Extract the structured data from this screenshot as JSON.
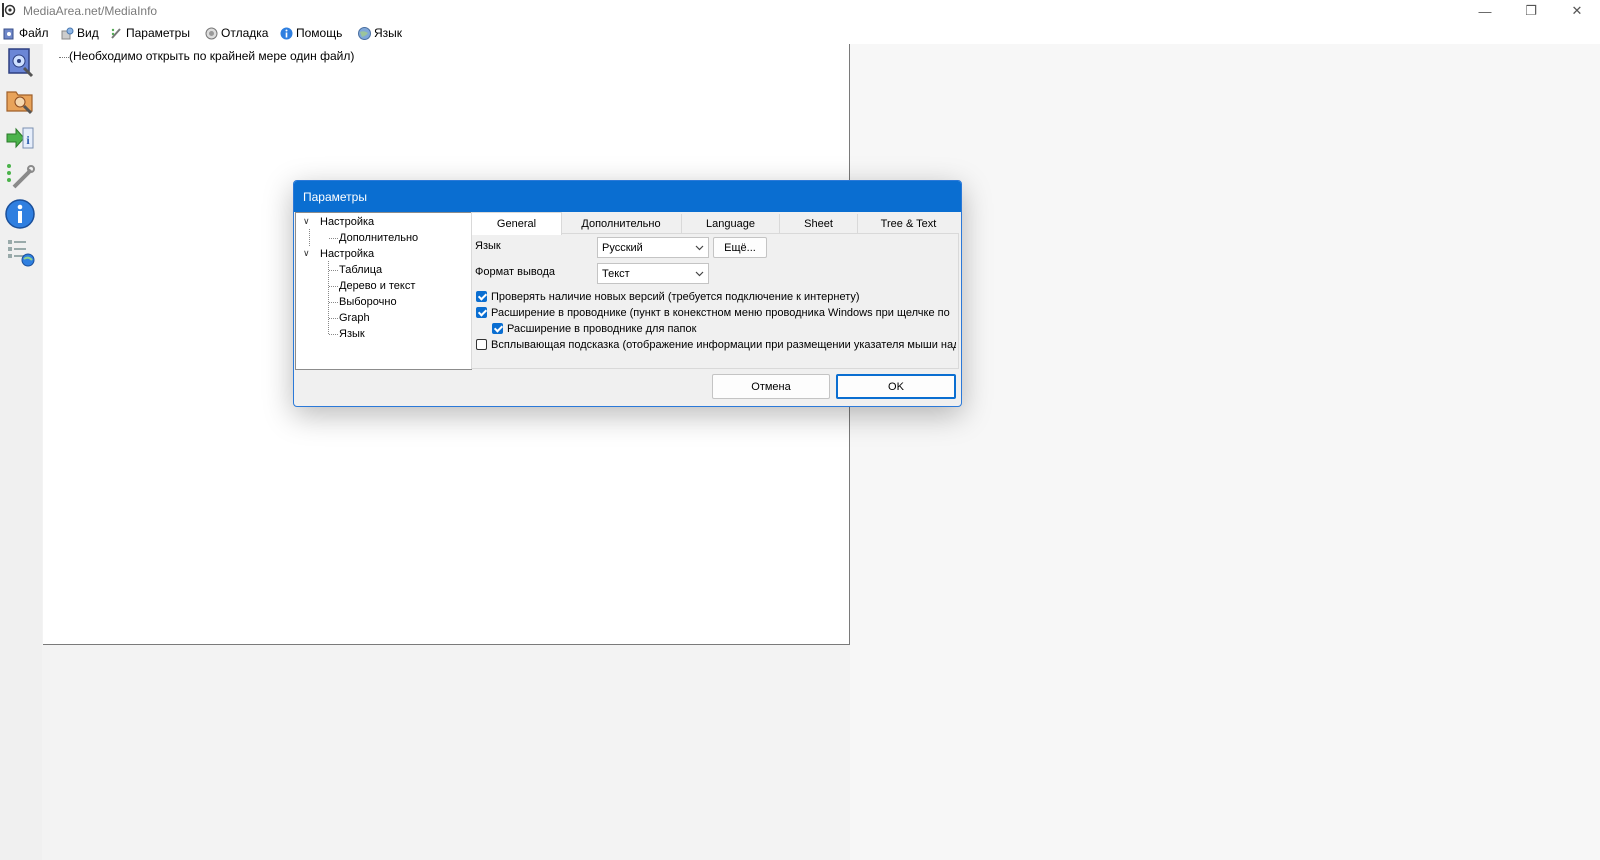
{
  "window": {
    "title": "MediaArea.net/MediaInfo",
    "controls": {
      "minimize": "—",
      "restore": "❐",
      "close": "✕"
    }
  },
  "menu": [
    {
      "label": "Файл",
      "icon": "file-icon"
    },
    {
      "label": "Вид",
      "icon": "view-icon"
    },
    {
      "label": "Параметры",
      "icon": "options-icon"
    },
    {
      "label": "Отладка",
      "icon": "debug-icon"
    },
    {
      "label": "Помощь",
      "icon": "help-icon"
    },
    {
      "label": "Язык",
      "icon": "language-icon"
    }
  ],
  "toolbar": [
    {
      "icon": "open-file-icon"
    },
    {
      "icon": "open-folder-icon"
    },
    {
      "icon": "export-icon"
    },
    {
      "icon": "preferences-icon"
    },
    {
      "icon": "info-icon"
    },
    {
      "icon": "web-info-icon"
    }
  ],
  "main": {
    "empty_message": "(Необходимо открыть по крайней мере один файл)"
  },
  "dialog": {
    "title": "Параметры",
    "tree": [
      {
        "label": "Настройка",
        "level": 0,
        "expanded": true
      },
      {
        "label": "Дополнительно",
        "level": 1
      },
      {
        "label": "Настройка",
        "level": 0,
        "expanded": true
      },
      {
        "label": "Таблица",
        "level": 1
      },
      {
        "label": "Дерево и текст",
        "level": 1
      },
      {
        "label": "Выборочно",
        "level": 1
      },
      {
        "label": "Graph",
        "level": 1
      },
      {
        "label": "Язык",
        "level": 1
      }
    ],
    "tabs": [
      {
        "label": "General",
        "active": true
      },
      {
        "label": "Дополнительно",
        "active": false
      },
      {
        "label": "Language",
        "active": false
      },
      {
        "label": "Sheet",
        "active": false
      },
      {
        "label": "Tree & Text",
        "active": false
      }
    ],
    "general": {
      "language_label": "Язык",
      "language_value": "Русский",
      "more_button": "Ещё...",
      "output_label": "Формат вывода",
      "output_value": "Текст",
      "checkboxes": [
        {
          "label": "Проверять наличие новых версий (требуется подключение к интернету)",
          "checked": true
        },
        {
          "label": "Расширение в проводнике (пункт в конекстном меню проводника Windows при щелчке по",
          "checked": true
        },
        {
          "label": "Расширение в проводнике для папок",
          "checked": true
        },
        {
          "label": "Всплывающая подсказка (отображение информации при размещении указателя мыши над",
          "checked": false
        }
      ]
    },
    "buttons": {
      "cancel": "Отмена",
      "ok": "OK"
    },
    "accent_color": "#0a6ed1"
  }
}
